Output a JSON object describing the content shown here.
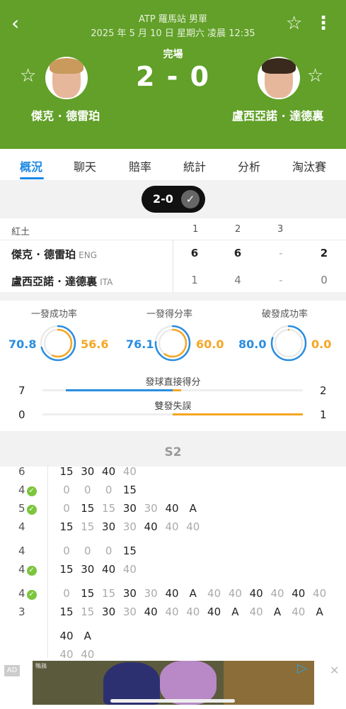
{
  "header": {
    "title": "ATP 羅馬站 男單",
    "datetime": "2025 年 5 月 10 日 星期六 凌晨 12:35",
    "status": "完場",
    "score": "2 - 0",
    "back_icon": "‹",
    "star_icon": "☆",
    "more_icon": "⋮",
    "player1": {
      "name": "傑克 · 德雷珀"
    },
    "player2": {
      "name": "盧西亞諾 · 達德裏"
    }
  },
  "tabs": [
    "概況",
    "聊天",
    "賠率",
    "統計",
    "分析",
    "淘汰賽"
  ],
  "set_selector": {
    "label": "2-0",
    "check_icon": "✓"
  },
  "score_table": {
    "surface": "紅土",
    "set_headers": [
      "1",
      "2",
      "3"
    ],
    "rows": [
      {
        "name": "傑克 · 德雷珀",
        "nat": "ENG",
        "sets": [
          "6",
          "6",
          "-"
        ],
        "total": "2"
      },
      {
        "name": "盧西亞諾 · 達德裏",
        "nat": "ITA",
        "sets": [
          "1",
          "4",
          "-"
        ],
        "total": "0"
      }
    ]
  },
  "stats": {
    "rings": [
      {
        "label": "一發成功率",
        "left": "70.8",
        "right": "56.6",
        "left_pct": 70.8,
        "right_pct": 56.6
      },
      {
        "label": "一發得分率",
        "left": "76.1",
        "right": "60.0",
        "left_pct": 76.1,
        "right_pct": 60.0
      },
      {
        "label": "破發成功率",
        "left": "80.0",
        "right": "0.0",
        "left_pct": 80.0,
        "right_pct": 0.0
      }
    ],
    "bars": [
      {
        "label": "發球直接得分",
        "left": "7",
        "right": "2",
        "left_val": 7,
        "right_val": 2
      },
      {
        "label": "雙發失誤",
        "left": "0",
        "right": "1",
        "left_val": 0,
        "right_val": 1
      }
    ]
  },
  "pbp": {
    "title": "S2",
    "games": [
      {
        "top_score": "6",
        "bottom_score": "4",
        "server": "bottom",
        "top_points": [
          [
            "15",
            "b"
          ],
          [
            "30",
            "b"
          ],
          [
            "40",
            "b"
          ],
          [
            "40",
            "g"
          ]
        ],
        "bottom_points": [
          [
            "0",
            "g"
          ],
          [
            "0",
            "g"
          ],
          [
            "0",
            "g"
          ],
          [
            "15",
            "b"
          ]
        ]
      },
      {
        "top_score": "5",
        "bottom_score": "4",
        "server": "top",
        "top_points": [
          [
            "0",
            "g"
          ],
          [
            "15",
            "b"
          ],
          [
            "15",
            "g"
          ],
          [
            "30",
            "b"
          ],
          [
            "30",
            "g"
          ],
          [
            "40",
            "b"
          ],
          [
            "A",
            "b"
          ]
        ],
        "bottom_points": [
          [
            "15",
            "b"
          ],
          [
            "15",
            "g"
          ],
          [
            "30",
            "b"
          ],
          [
            "30",
            "g"
          ],
          [
            "40",
            "b"
          ],
          [
            "40",
            "g"
          ],
          [
            "40",
            "g"
          ]
        ]
      },
      {
        "top_score": "4",
        "bottom_score": "4",
        "server": "bottom",
        "top_points": [
          [
            "0",
            "g"
          ],
          [
            "0",
            "g"
          ],
          [
            "0",
            "g"
          ],
          [
            "15",
            "b"
          ]
        ],
        "bottom_points": [
          [
            "15",
            "b"
          ],
          [
            "30",
            "b"
          ],
          [
            "40",
            "b"
          ],
          [
            "40",
            "g"
          ]
        ]
      },
      {
        "top_score": "4",
        "bottom_score": "3",
        "server": "top",
        "top_points": [
          [
            "0",
            "g"
          ],
          [
            "15",
            "b"
          ],
          [
            "15",
            "g"
          ],
          [
            "30",
            "b"
          ],
          [
            "30",
            "g"
          ],
          [
            "40",
            "b"
          ],
          [
            "A",
            "b"
          ],
          [
            "40",
            "g"
          ],
          [
            "40",
            "g"
          ],
          [
            "40",
            "b"
          ],
          [
            "40",
            "g"
          ],
          [
            "40",
            "b"
          ],
          [
            "40",
            "g"
          ]
        ],
        "bottom_points": [
          [
            "15",
            "b"
          ],
          [
            "15",
            "g"
          ],
          [
            "30",
            "b"
          ],
          [
            "30",
            "g"
          ],
          [
            "40",
            "b"
          ],
          [
            "40",
            "g"
          ],
          [
            "40",
            "g"
          ],
          [
            "40",
            "b"
          ],
          [
            "A",
            "b"
          ],
          [
            "40",
            "g"
          ],
          [
            "A",
            "b"
          ],
          [
            "40",
            "g"
          ],
          [
            "A",
            "b"
          ]
        ],
        "extra_points": [
          [
            "40",
            "b"
          ],
          [
            "A",
            "b"
          ]
        ],
        "extra_points2": [
          [
            "40",
            "g"
          ],
          [
            "40",
            "g"
          ]
        ]
      }
    ],
    "serve_icon": "✓"
  },
  "ad": {
    "tag": "AD",
    "close_icon": "✕",
    "play_icon": "▷",
    "brand": "鴨鴉"
  },
  "colors": {
    "header_green": "#62a029",
    "accent_blue": "#1e88e5",
    "orange": "#f5a623",
    "serve_green": "#7cc53e"
  }
}
